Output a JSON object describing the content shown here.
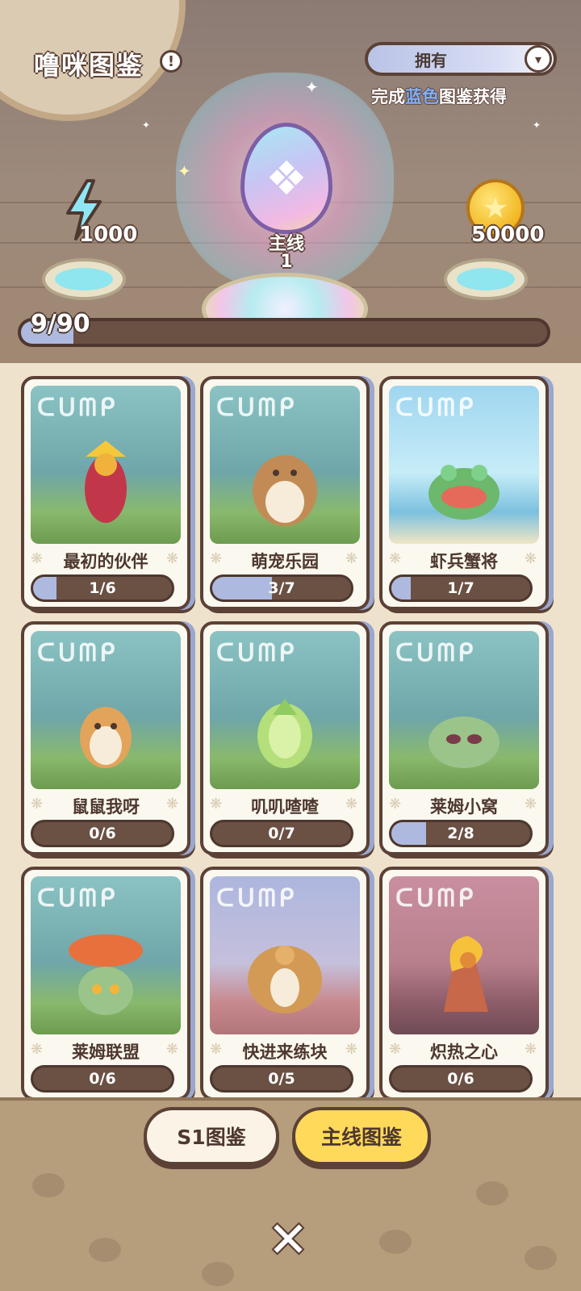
{
  "header": {
    "title": "噜咪图鉴",
    "info_icon_label": "!",
    "owned_dropdown_label": "拥有",
    "hint_prefix": "完成",
    "hint_blue": "蓝色",
    "hint_suffix": "图鉴获得",
    "reward_left_value": "1000",
    "reward_right_value": "50000",
    "main_label": "主线",
    "main_count": "1",
    "progress_text": "9/90",
    "progress_fraction": 0.1
  },
  "cards": [
    {
      "name": "最初的伙伴",
      "progress": "1/6",
      "fill": 0.17,
      "bg": "forest",
      "logo": "ᑕᑌᗰᑭ"
    },
    {
      "name": "萌宠乐园",
      "progress": "3/7",
      "fill": 0.43,
      "bg": "forest",
      "logo": "ᑕᑌᗰᑭ"
    },
    {
      "name": "虾兵蟹将",
      "progress": "1/7",
      "fill": 0.14,
      "bg": "sky",
      "logo": "ᑕᑌᗰᑭ"
    },
    {
      "name": "鼠鼠我呀",
      "progress": "0/6",
      "fill": 0,
      "bg": "forest",
      "logo": "ᑕᑌᗰᑭ"
    },
    {
      "name": "叽叽喳喳",
      "progress": "0/7",
      "fill": 0,
      "bg": "forest",
      "logo": "ᑕᑌᗰᑭ"
    },
    {
      "name": "莱姆小窝",
      "progress": "2/8",
      "fill": 0.25,
      "bg": "forest",
      "logo": "ᑕᑌᗰᑭ"
    },
    {
      "name": "莱姆联盟",
      "progress": "0/6",
      "fill": 0,
      "bg": "forest",
      "logo": "ᑕᑌᗰᑭ"
    },
    {
      "name": "快进来练块",
      "progress": "0/5",
      "fill": 0,
      "bg": "rock",
      "logo": "ᑕᑌᗰᑭ"
    },
    {
      "name": "炽热之心",
      "progress": "0/6",
      "fill": 0,
      "bg": "lava",
      "logo": "ᑕᑌᗰᑭ"
    }
  ],
  "tabs": {
    "s1_label": "S1图鉴",
    "main_label": "主线图鉴"
  },
  "close_label": "✕",
  "colors": {
    "accent_blue": "#7fb1ff",
    "progress_fill": "#aeb9df",
    "bar_track": "#6b5044",
    "active_tab": "#ffd95a",
    "outline": "#5b4136"
  }
}
